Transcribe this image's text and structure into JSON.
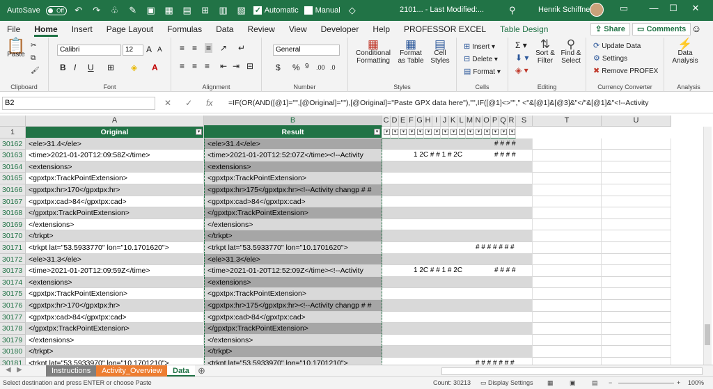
{
  "titlebar": {
    "autosave": "AutoSave",
    "autosave_state": "Off",
    "automatic": "Automatic",
    "manual": "Manual",
    "file_title": "2101... - Last Modified:...",
    "user": "Henrik Schiffner"
  },
  "menu": {
    "tabs": [
      "File",
      "Home",
      "Insert",
      "Page Layout",
      "Formulas",
      "Data",
      "Review",
      "View",
      "Developer",
      "Help",
      "PROFESSOR EXCEL",
      "Table Design"
    ],
    "share": "Share",
    "comments": "Comments"
  },
  "ribbon": {
    "clipboard": {
      "label": "Clipboard",
      "paste": "Paste"
    },
    "font": {
      "label": "Font",
      "name": "Calibri",
      "size": "12"
    },
    "alignment": {
      "label": "Alignment"
    },
    "number": {
      "label": "Number",
      "format": "General"
    },
    "styles": {
      "label": "Styles",
      "conditional": "Conditional Formatting",
      "format_table": "Format as Table",
      "cell_styles": "Cell Styles"
    },
    "cells": {
      "label": "Cells",
      "insert": "Insert",
      "delete": "Delete",
      "format": "Format"
    },
    "editing": {
      "label": "Editing",
      "sort": "Sort & Filter",
      "find": "Find & Select"
    },
    "currency": {
      "label": "Currency Converter",
      "update": "Update Data",
      "settings": "Settings",
      "remove": "Remove PROFEX"
    },
    "analysis": {
      "label": "Analysis",
      "data_analysis": "Data Analysis"
    }
  },
  "formula_bar": {
    "name_box": "B2",
    "fx": "fx",
    "formula": "=IF(OR(AND([@1]=\"\",[@Original]=\"\"),[@Original]=\"Paste GPX data here\"),\"\",IF([@1]<>\"\",\"         <\"&[@1]&[@3]&\"</\"&[@1]&\"<!--Activity"
  },
  "grid": {
    "columns": [
      "A",
      "B",
      "C",
      "D",
      "E",
      "F",
      "G",
      "H",
      "I",
      "J",
      "K",
      "L",
      "M",
      "N",
      "O",
      "P",
      "Q",
      "R",
      "S",
      "T",
      "U"
    ],
    "header_row": "1",
    "col_a_header": "Original",
    "col_b_header": "Result",
    "rows": [
      {
        "n": "30162",
        "a": "  <ele>31.4</ele>",
        "b": "  <ele>31.4</ele>",
        "h": "# # # #",
        "extra": ""
      },
      {
        "n": "30163",
        "a": "  <time>2021-01-20T12:09:58Z</time>",
        "b": "<time>2021-01-20T12:52:07Z</time><!--Activity",
        "h": "# # # #",
        "extra": "1 2C  #  #   1  #  2C"
      },
      {
        "n": "30164",
        "a": "  <extensions>",
        "b": "  <extensions>",
        "h": "",
        "extra": ""
      },
      {
        "n": "30165",
        "a": "   <gpxtpx:TrackPointExtension>",
        "b": "   <gpxtpx:TrackPointExtension>",
        "h": "",
        "extra": ""
      },
      {
        "n": "30166",
        "a": "     <gpxtpx:hr>170</gpxtpx:hr>",
        "b": "        <gpxtpx:hr>175</gpxtpx:hr><!--Activity changp # #",
        "h": "",
        "extra": ""
      },
      {
        "n": "30167",
        "a": "     <gpxtpx:cad>84</gpxtpx:cad>",
        "b": "     <gpxtpx:cad>84</gpxtpx:cad>",
        "h": "",
        "extra": ""
      },
      {
        "n": "30168",
        "a": "   </gpxtpx:TrackPointExtension>",
        "b": "   </gpxtpx:TrackPointExtension>",
        "h": "",
        "extra": ""
      },
      {
        "n": "30169",
        "a": "  </extensions>",
        "b": "  </extensions>",
        "h": "",
        "extra": ""
      },
      {
        "n": "30170",
        "a": "  </trkpt>",
        "b": "  </trkpt>",
        "h": "",
        "extra": ""
      },
      {
        "n": "30171",
        "a": "  <trkpt lat=\"53.5933770\" lon=\"10.1701620\">",
        "b": "<trkpt lat=\"53.5933770\" lon=\"10.1701620\">",
        "h": "# # # # # # #",
        "extra": ""
      },
      {
        "n": "30172",
        "a": "  <ele>31.3</ele>",
        "b": "  <ele>31.3</ele>",
        "h": "",
        "extra": ""
      },
      {
        "n": "30173",
        "a": "  <time>2021-01-20T12:09:59Z</time>",
        "b": "<time>2021-01-20T12:52:09Z</time><!--Activity",
        "h": "# # # #",
        "extra": "1 2C  #  #   1  #  2C"
      },
      {
        "n": "30174",
        "a": "  <extensions>",
        "b": "  <extensions>",
        "h": "",
        "extra": ""
      },
      {
        "n": "30175",
        "a": "   <gpxtpx:TrackPointExtension>",
        "b": "   <gpxtpx:TrackPointExtension>",
        "h": "",
        "extra": ""
      },
      {
        "n": "30176",
        "a": "     <gpxtpx:hr>170</gpxtpx:hr>",
        "b": "        <gpxtpx:hr>175</gpxtpx:hr><!--Activity changp # #",
        "h": "",
        "extra": ""
      },
      {
        "n": "30177",
        "a": "     <gpxtpx:cad>84</gpxtpx:cad>",
        "b": "     <gpxtpx:cad>84</gpxtpx:cad>",
        "h": "",
        "extra": ""
      },
      {
        "n": "30178",
        "a": "   </gpxtpx:TrackPointExtension>",
        "b": "   </gpxtpx:TrackPointExtension>",
        "h": "",
        "extra": ""
      },
      {
        "n": "30179",
        "a": "  </extensions>",
        "b": "  </extensions>",
        "h": "",
        "extra": ""
      },
      {
        "n": "30180",
        "a": "  </trkpt>",
        "b": "  </trkpt>",
        "h": "",
        "extra": ""
      },
      {
        "n": "30181",
        "a": "  <trkpt lat=\"53.5933970\" lon=\"10.1701210\">",
        "b": "<trkpt lat=\"53.5933970\" lon=\"10.1701210\">",
        "h": "# # # # # # #",
        "extra": ""
      }
    ]
  },
  "sheets": [
    "Instructions",
    "Activity_Overview",
    "Data"
  ],
  "status": {
    "message": "Select destination and press ENTER or choose Paste",
    "count": "Count: 30213",
    "display_settings": "Display Settings",
    "zoom": "100%"
  }
}
